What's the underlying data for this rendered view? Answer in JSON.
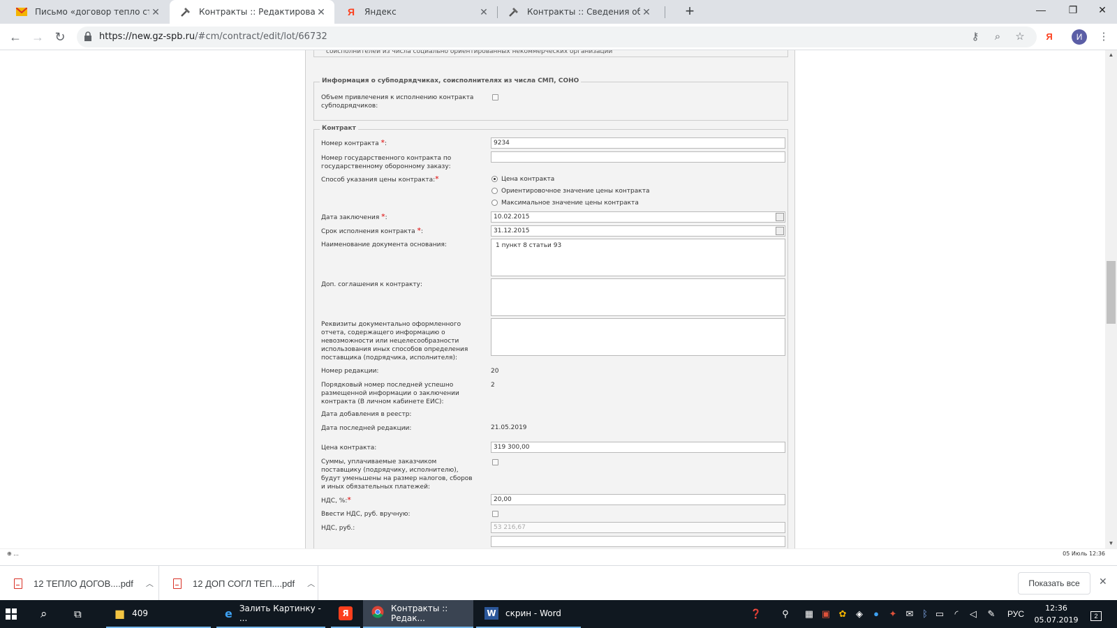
{
  "browser": {
    "tabs": [
      {
        "title": "Письмо «договор тепло старый",
        "icon": "mail-icon",
        "active": false
      },
      {
        "title": "Контракты :: Редактирование ко",
        "icon": "tools-icon",
        "active": true
      },
      {
        "title": "Яндекс",
        "icon": "yandex-icon",
        "active": false
      },
      {
        "title": "Контракты :: Сведения об испол",
        "icon": "tools-icon",
        "active": false
      }
    ],
    "url_host": "https://new.gz-spb.ru",
    "url_path": "/#cm/contract/edit/lot/66732",
    "profile_initial": "И",
    "yandex_glyph": "Я"
  },
  "form": {
    "top_partial_text": "соисполнителей из числа социально ориентированных некоммерческих организаций",
    "subcontractors": {
      "legend": "Информация о субподрядчиках, соисполнителях из числа СМП, СОНО",
      "volume_label": "Объем привлечения к исполнению контракта субподрядчиков:"
    },
    "contract": {
      "legend": "Контракт",
      "number_label": "Номер контракта ",
      "number_value": "9234",
      "gov_number_label": "Номер государственного контракта по государственному оборонному заказу:",
      "price_method_label": "Способ указания цены контракта:",
      "price_methods": [
        "Цена контракта",
        "Ориентировочное значение цены контракта",
        "Максимальное значение цены контракта"
      ],
      "date_label": "Дата заключения ",
      "date_value": "10.02.2015",
      "term_label": "Срок исполнения контракта ",
      "term_value": "31.12.2015",
      "basis_label": "Наименование документа основания:",
      "basis_value": "1 пункт 8 статьи 93",
      "addendum_label": "Доп. соглашения к контракту:",
      "report_label": "Реквизиты документально оформленного отчета, содержащего информацию о невозможности или нецелесообразности использования иных способов определения поставщика (подрядчика, исполнителя):",
      "revision_label": "Номер редакции:",
      "revision_value": "20",
      "last_info_label": "Порядковый номер последней успешно размещенной информации о заключении контракта (В личном кабинете ЕИС):",
      "last_info_value": "2",
      "registry_date_label": "Дата добавления в реестр:",
      "last_revision_date_label": "Дата последней редакции:",
      "last_revision_date_value": "21.05.2019",
      "price_label": "Цена контракта:",
      "price_value": "319 300,00",
      "taxes_label": "Суммы, уплачиваемые заказчиком поставщику (подрядчику, исполнителю), будут уменьшены на размер налогов, сборов и иных обязательных платежей:",
      "vat_label": "НДС, %:",
      "vat_value": "20,00",
      "vat_manual_label": "Ввести НДС, руб. вручную:",
      "vat_rub_label": "НДС, руб.:",
      "vat_rub_value": "53 216,67"
    },
    "required_mark": "*",
    "colon": ":"
  },
  "status": {
    "left": "⊕ ...",
    "right": "05 Июль 12:36"
  },
  "downloads": [
    {
      "name": "12 ТЕПЛО ДОГОВ....pdf"
    },
    {
      "name": "12 ДОП СОГЛ ТЕП....pdf"
    }
  ],
  "downloads_show_all": "Показать все",
  "taskbar": {
    "folder_label": "409",
    "ie_label": "Залить Картинку - ...",
    "chrome_label": "Контракты :: Редак...",
    "word_label": "скрин - Word",
    "lang": "РУС",
    "time": "12:36",
    "date": "05.07.2019",
    "notifications": "2"
  }
}
